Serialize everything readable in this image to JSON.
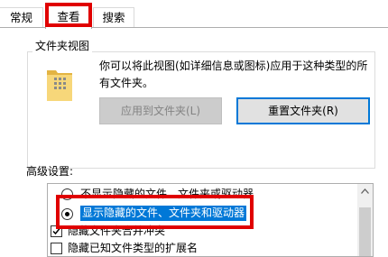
{
  "tabs": [
    {
      "label": "常规"
    },
    {
      "label": "查看"
    },
    {
      "label": "搜索"
    }
  ],
  "folder_views": {
    "legend": "文件夹视图",
    "description": "你可以将此视图(如详细信息或图标)应用于这种类型的所有文件夹。",
    "apply_button": "应用到文件夹(L)",
    "reset_button": "重置文件夹(R)"
  },
  "advanced": {
    "label": "高级设置:",
    "options": [
      {
        "label": "不显示隐藏的文件、文件夹或驱动器",
        "type": "radio",
        "checked": false
      },
      {
        "label": "显示隐藏的文件、文件夹和驱动器",
        "type": "radio",
        "checked": true
      },
      {
        "label": "隐藏文件夹合并冲突",
        "type": "checkbox",
        "checked": true
      },
      {
        "label": "隐藏已知文件类型的扩展名",
        "type": "checkbox",
        "checked": false
      }
    ]
  },
  "colors": {
    "annotation": "#e00000",
    "selection": "#0078d7",
    "default_button_border": "#0078d7"
  },
  "icons": [
    "folder-icon",
    "scroll-up-arrow-icon",
    "checkmark-icon"
  ]
}
